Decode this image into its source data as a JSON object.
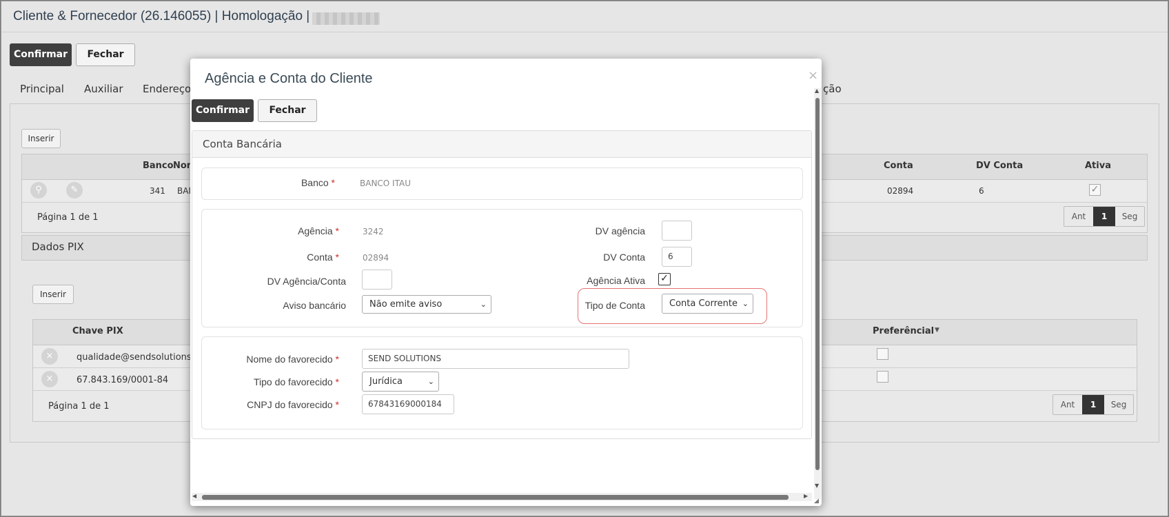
{
  "window": {
    "title": "Cliente & Fornecedor (26.146055) | Homologação |"
  },
  "toolbar": {
    "confirm_label": "Confirmar",
    "close_label": "Fechar"
  },
  "tabs": [
    "Principal",
    "Auxiliar",
    "Endereços",
    "ção"
  ],
  "bank_table": {
    "insert_label": "Inserir",
    "headers": {
      "banco": "Banco",
      "nome": "Nom",
      "conta": "Conta",
      "dv_conta": "DV Conta",
      "ativa": "Ativa"
    },
    "row": {
      "banco": "341",
      "nome": "BAN",
      "conta": "02894",
      "dv_conta": "6",
      "ativa": true
    },
    "page_info": "Página 1 de 1",
    "pager": {
      "prev": "Ant",
      "current": "1",
      "next": "Seg"
    }
  },
  "pix": {
    "section_title": "Dados PIX",
    "insert_label": "Inserir",
    "headers": {
      "chave": "Chave PIX",
      "preferencial": "Preferêncial"
    },
    "rows": [
      {
        "chave": "qualidade@sendsolutions.co"
      },
      {
        "chave": "67.843.169/0001-84"
      }
    ],
    "page_info": "Página 1 de 1",
    "pager": {
      "prev": "Ant",
      "current": "1",
      "next": "Seg"
    }
  },
  "modal": {
    "title": "Agência e Conta do Cliente",
    "close_icon": "×",
    "confirm_label": "Confirmar",
    "close_label": "Fechar",
    "section_title": "Conta Bancária",
    "banco_label": "Banco",
    "banco_value": "BANCO ITAU",
    "agencia_label": "Agência",
    "agencia_value": "3242",
    "conta_label": "Conta",
    "conta_value": "02894",
    "dv_agencia_conta_label": "DV Agência/Conta",
    "aviso_label": "Aviso bancário",
    "aviso_value": "Não emite aviso",
    "dv_agencia_label": "DV agência",
    "dv_agencia_value": "",
    "dv_conta_label": "DV Conta",
    "dv_conta_value": "6",
    "agencia_ativa_label": "Agência Ativa",
    "agencia_ativa_checked": true,
    "tipo_conta_label": "Tipo de Conta",
    "tipo_conta_value": "Conta Corrente",
    "nome_fav_label": "Nome do favorecido",
    "nome_fav_value": "SEND SOLUTIONS",
    "tipo_fav_label": "Tipo do favorecido",
    "tipo_fav_value": "Jurídica",
    "cnpj_fav_label": "CNPJ do favorecido",
    "cnpj_fav_value": "67843169000184",
    "required_marker": "*"
  },
  "colors": {
    "dark_button": "#3f3f3f",
    "required": "#c9302c",
    "highlight": "#e57373"
  }
}
